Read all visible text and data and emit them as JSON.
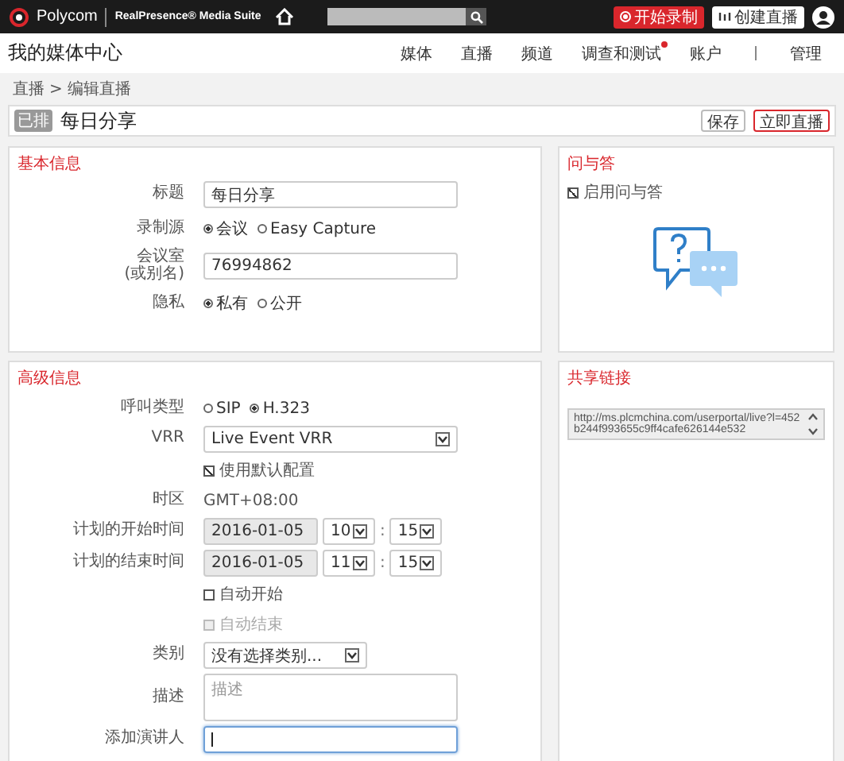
{
  "top_bar": {
    "brand": "Polycom",
    "product": "RealPresence® Media Suite",
    "buttons": [
      {
        "label": "开始录制",
        "kind": "record"
      },
      {
        "label": "创建直播",
        "kind": "create"
      }
    ]
  },
  "header": {
    "title": "我的媒体中心",
    "nav": [
      {
        "label": "媒体",
        "notification": false
      },
      {
        "label": "直播",
        "notification": false
      },
      {
        "label": "频道",
        "notification": false
      },
      {
        "label": "调查和测试",
        "notification": true
      },
      {
        "label": "账户",
        "notification": false
      },
      {
        "label": "管理",
        "notification": false
      }
    ]
  },
  "breadcrumb": {
    "items": [
      "直播",
      "编辑直播"
    ],
    "separator": ">"
  },
  "page_header": {
    "badge": "已排",
    "title": "每日分享",
    "buttons": [
      {
        "label": "保存",
        "kind": "default"
      },
      {
        "label": "立即直播",
        "kind": "primary"
      }
    ]
  },
  "basic_info": {
    "heading": "基本信息",
    "fields": [
      {
        "kind": "text",
        "label": "标题",
        "value": "每日分享"
      },
      {
        "kind": "radio",
        "label": "录制源",
        "options": [
          {
            "label": "会议",
            "selected": true
          },
          {
            "label": "Easy Capture",
            "selected": false
          }
        ]
      },
      {
        "kind": "text",
        "label": "会议室",
        "sublabel": "(或别名)",
        "value": "76994862"
      },
      {
        "kind": "radio",
        "label": "隐私",
        "options": [
          {
            "label": "私有",
            "selected": true
          },
          {
            "label": "公开",
            "selected": false
          }
        ]
      }
    ]
  },
  "qa": {
    "heading": "问与答",
    "checkbox": {
      "label": "启用问与答",
      "checked": true
    }
  },
  "advanced": {
    "heading": "高级信息",
    "fields": [
      {
        "kind": "radio",
        "label": "呼叫类型",
        "options": [
          {
            "label": "SIP",
            "selected": false
          },
          {
            "label": "H.323",
            "selected": true
          }
        ]
      },
      {
        "kind": "select",
        "label": "VRR",
        "value": "Live Event VRR"
      },
      {
        "kind": "checkbox",
        "label": "使用默认配置",
        "checked": true,
        "disabled": false
      },
      {
        "kind": "static",
        "label": "时区",
        "value": "GMT+08:00"
      },
      {
        "kind": "datetime",
        "label": "计划的开始时间",
        "date": "2016-01-05",
        "hour": "10",
        "minute": "15",
        "separator": ":"
      },
      {
        "kind": "datetime",
        "label": "计划的结束时间",
        "date": "2016-01-05",
        "hour": "11",
        "minute": "15",
        "separator": ":"
      },
      {
        "kind": "checkbox",
        "label": "自动开始",
        "checked": false,
        "disabled": false
      },
      {
        "kind": "checkbox",
        "label": "自动结束",
        "checked": false,
        "disabled": true
      },
      {
        "kind": "select",
        "label": "类别",
        "value": "没有选择类别..."
      },
      {
        "kind": "textarea",
        "label": "描述",
        "placeholder": "描述"
      },
      {
        "kind": "text",
        "label": "添加演讲人",
        "focused": true
      }
    ]
  },
  "share_link": {
    "heading": "共享链接",
    "url": "http://ms.plcmchina.com/userportal/live?l=452b244f993655c9ff4cafe626144e532"
  }
}
